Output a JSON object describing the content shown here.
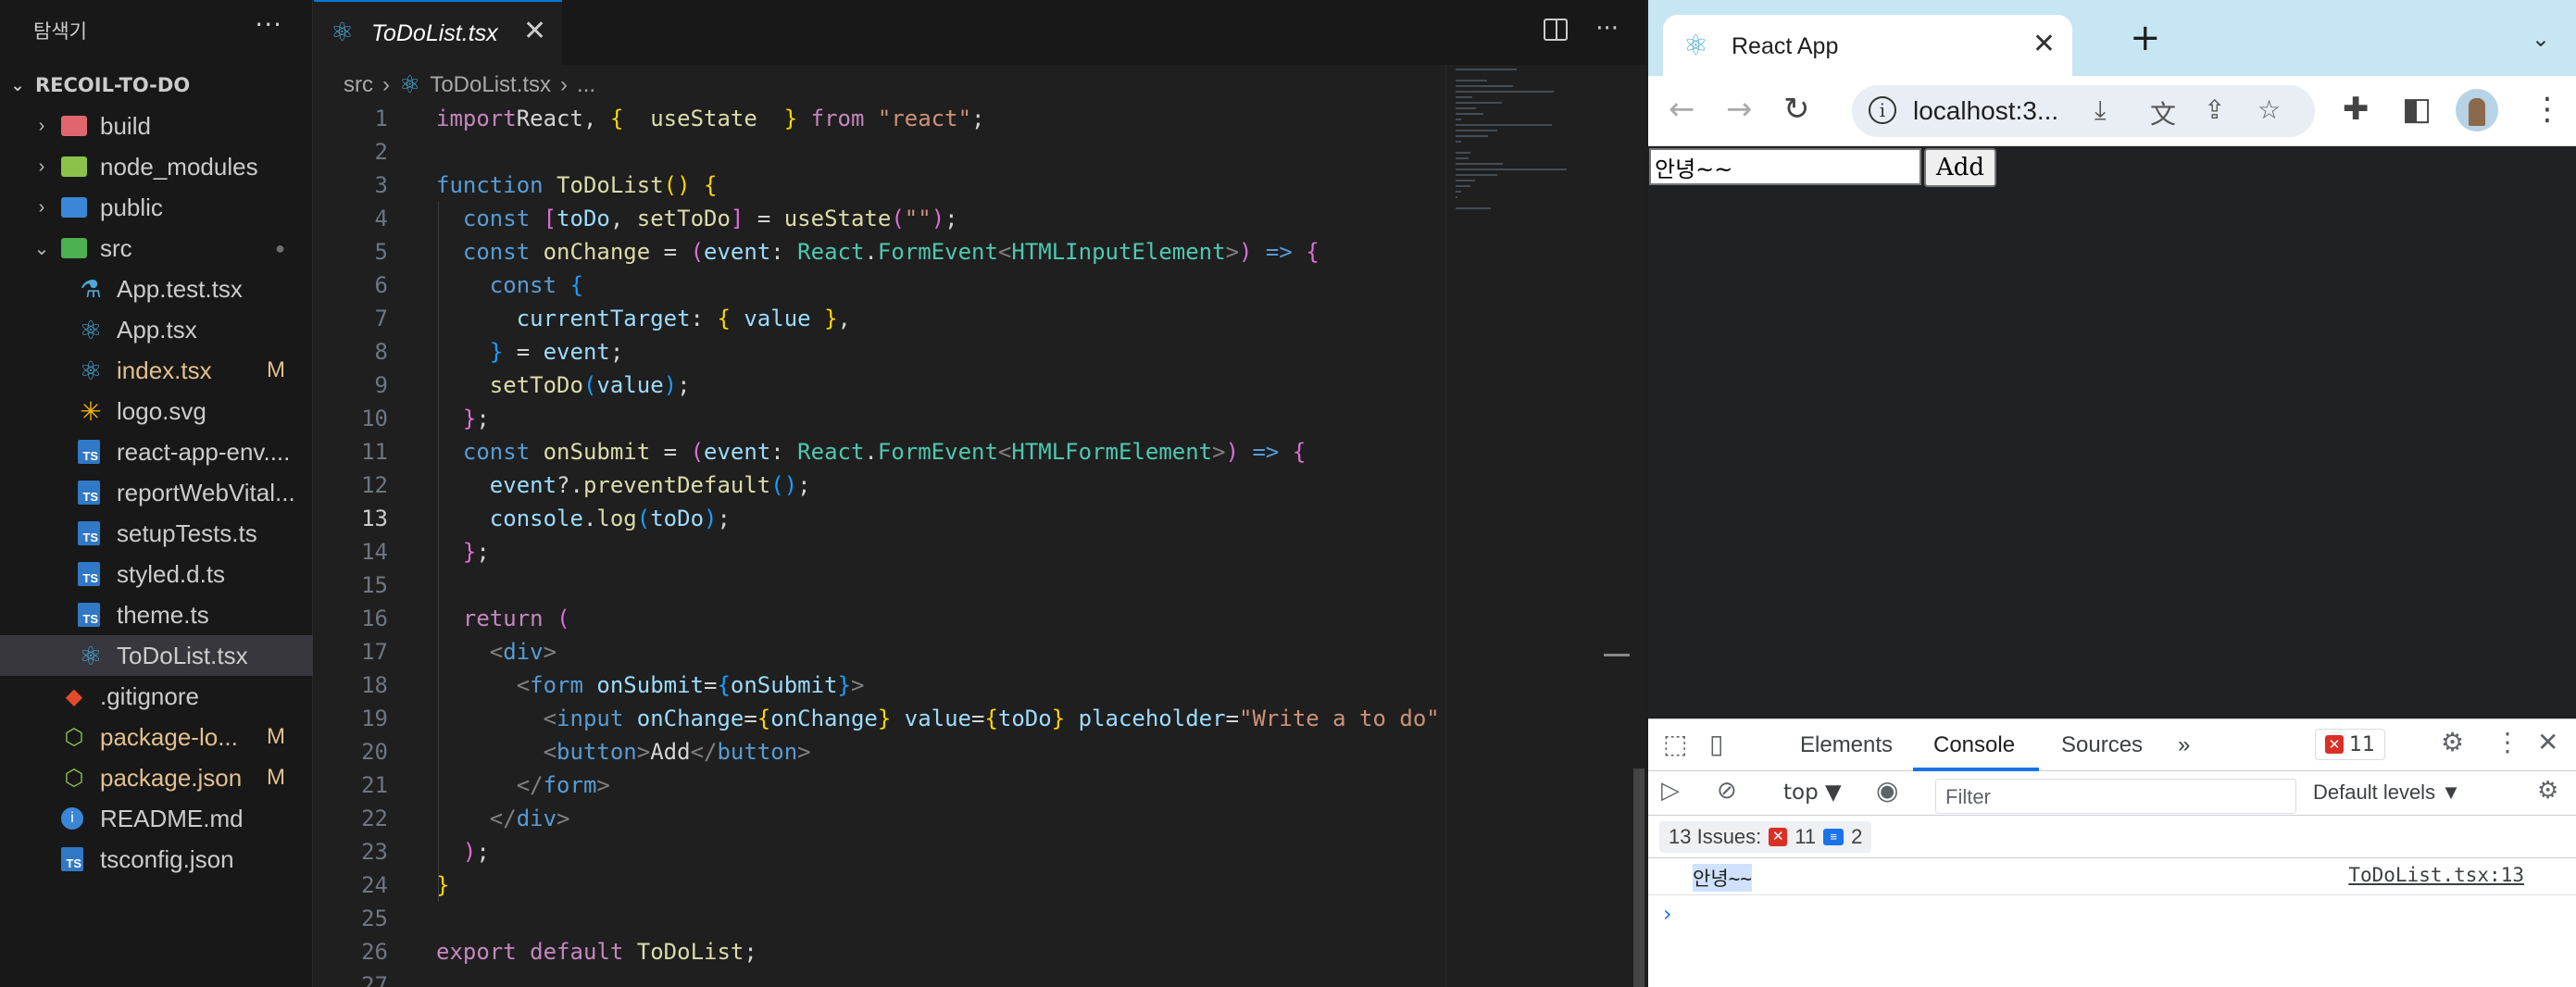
{
  "vscode": {
    "explorer_title": "탐색기",
    "more": "···",
    "root_folder": "RECOIL-TO-DO",
    "tree": [
      {
        "label": "build",
        "kind": "folder",
        "color": "#e0666e",
        "depth": 0,
        "open": false
      },
      {
        "label": "node_modules",
        "kind": "folder",
        "color": "#8bc34a",
        "depth": 0,
        "open": false
      },
      {
        "label": "public",
        "kind": "folder",
        "color": "#3b86d6",
        "depth": 0,
        "open": false
      },
      {
        "label": "src",
        "kind": "folder",
        "color": "#4caf50",
        "depth": 0,
        "open": true,
        "badge": "●"
      },
      {
        "label": "App.test.tsx",
        "kind": "test",
        "depth": 1
      },
      {
        "label": "App.tsx",
        "kind": "react",
        "depth": 1
      },
      {
        "label": "index.tsx",
        "kind": "react",
        "depth": 1,
        "badge": "M",
        "modified": true
      },
      {
        "label": "logo.svg",
        "kind": "svg",
        "depth": 1
      },
      {
        "label": "react-app-env....",
        "kind": "ts",
        "depth": 1
      },
      {
        "label": "reportWebVital...",
        "kind": "ts",
        "depth": 1
      },
      {
        "label": "setupTests.ts",
        "kind": "ts",
        "depth": 1
      },
      {
        "label": "styled.d.ts",
        "kind": "ts",
        "depth": 1
      },
      {
        "label": "theme.ts",
        "kind": "ts",
        "depth": 1
      },
      {
        "label": "ToDoList.tsx",
        "kind": "react",
        "depth": 1,
        "selected": true
      },
      {
        "label": ".gitignore",
        "kind": "git",
        "depth": 0
      },
      {
        "label": "package-lo...",
        "kind": "json",
        "depth": 0,
        "badge": "M",
        "modified": true
      },
      {
        "label": "package.json",
        "kind": "json",
        "depth": 0,
        "badge": "M",
        "modified": true
      },
      {
        "label": "README.md",
        "kind": "info",
        "depth": 0
      },
      {
        "label": "tsconfig.json",
        "kind": "tsjson",
        "depth": 0
      }
    ],
    "tab": {
      "label": "ToDoList.tsx",
      "close": "✕"
    },
    "breadcrumb": [
      "src",
      "ToDoList.tsx",
      "..."
    ],
    "line_numbers": [
      "1",
      "2",
      "3",
      "4",
      "5",
      "6",
      "7",
      "8",
      "9",
      "10",
      "11",
      "12",
      "13",
      "14",
      "15",
      "16",
      "17",
      "18",
      "19",
      "20",
      "21",
      "22",
      "23",
      "24",
      "25",
      "26",
      "27"
    ],
    "active_line": 13
  },
  "code_lines": [
    [
      [
        "kw",
        "import"
      ],
      [
        "",
        "React, "
      ],
      [
        "br1",
        "{"
      ],
      [
        "",
        "  "
      ],
      [
        "fn",
        "useState"
      ],
      [
        "",
        "  "
      ],
      [
        "br1",
        "}"
      ],
      [
        "",
        " "
      ],
      [
        "kw",
        "from"
      ],
      [
        "",
        " "
      ],
      [
        "st",
        "\"react\""
      ],
      [
        "",
        ";"
      ]
    ],
    [],
    [
      [
        "kw2",
        "function"
      ],
      [
        "",
        " "
      ],
      [
        "fn",
        "ToDoList"
      ],
      [
        "br1",
        "()"
      ],
      [
        "",
        " "
      ],
      [
        "br1",
        "{"
      ]
    ],
    [
      [
        "",
        "  "
      ],
      [
        "kw2",
        "const"
      ],
      [
        "",
        " "
      ],
      [
        "br2",
        "["
      ],
      [
        "va",
        "toDo"
      ],
      [
        "",
        ", "
      ],
      [
        "fn",
        "setToDo"
      ],
      [
        "br2",
        "]"
      ],
      [
        "",
        " = "
      ],
      [
        "fn",
        "useState"
      ],
      [
        "br2",
        "("
      ],
      [
        "st",
        "\"\""
      ],
      [
        "br2",
        ")"
      ],
      [
        "",
        ";"
      ]
    ],
    [
      [
        "",
        "  "
      ],
      [
        "kw2",
        "const"
      ],
      [
        "",
        " "
      ],
      [
        "fn",
        "onChange"
      ],
      [
        "",
        " = "
      ],
      [
        "br2",
        "("
      ],
      [
        "va",
        "event"
      ],
      [
        "",
        ": "
      ],
      [
        "ty",
        "React"
      ],
      [
        "",
        "."
      ],
      [
        "ty",
        "FormEvent"
      ],
      [
        "pu",
        "<"
      ],
      [
        "ty",
        "HTMLInputElement"
      ],
      [
        "pu",
        ">"
      ],
      [
        "br2",
        ")"
      ],
      [
        "",
        " "
      ],
      [
        "kw2",
        "=>"
      ],
      [
        "",
        " "
      ],
      [
        "br2",
        "{"
      ]
    ],
    [
      [
        "",
        "    "
      ],
      [
        "kw2",
        "const"
      ],
      [
        "",
        " "
      ],
      [
        "br3",
        "{"
      ]
    ],
    [
      [
        "",
        "      "
      ],
      [
        "va",
        "currentTarget"
      ],
      [
        "",
        ": "
      ],
      [
        "br1",
        "{"
      ],
      [
        "",
        " "
      ],
      [
        "va",
        "value"
      ],
      [
        "",
        " "
      ],
      [
        "br1",
        "}"
      ],
      [
        "",
        ","
      ]
    ],
    [
      [
        "",
        "    "
      ],
      [
        "br3",
        "}"
      ],
      [
        "",
        " = "
      ],
      [
        "va",
        "event"
      ],
      [
        "",
        ";"
      ]
    ],
    [
      [
        "",
        "    "
      ],
      [
        "fn",
        "setToDo"
      ],
      [
        "br3",
        "("
      ],
      [
        "va",
        "value"
      ],
      [
        "br3",
        ")"
      ],
      [
        "",
        ";"
      ]
    ],
    [
      [
        "",
        "  "
      ],
      [
        "br2",
        "}"
      ],
      [
        "",
        ";"
      ]
    ],
    [
      [
        "",
        "  "
      ],
      [
        "kw2",
        "const"
      ],
      [
        "",
        " "
      ],
      [
        "fn",
        "onSubmit"
      ],
      [
        "",
        " = "
      ],
      [
        "br2",
        "("
      ],
      [
        "va",
        "event"
      ],
      [
        "",
        ": "
      ],
      [
        "ty",
        "React"
      ],
      [
        "",
        "."
      ],
      [
        "ty",
        "FormEvent"
      ],
      [
        "pu",
        "<"
      ],
      [
        "ty",
        "HTMLFormElement"
      ],
      [
        "pu",
        ">"
      ],
      [
        "br2",
        ")"
      ],
      [
        "",
        " "
      ],
      [
        "kw2",
        "=>"
      ],
      [
        "",
        " "
      ],
      [
        "br2",
        "{"
      ]
    ],
    [
      [
        "",
        "    "
      ],
      [
        "va",
        "event"
      ],
      [
        "",
        "?."
      ],
      [
        "fn",
        "preventDefault"
      ],
      [
        "br3",
        "()"
      ],
      [
        "",
        ";"
      ]
    ],
    [
      [
        "",
        "    "
      ],
      [
        "va",
        "console"
      ],
      [
        "",
        "."
      ],
      [
        "fn",
        "log"
      ],
      [
        "br3",
        "("
      ],
      [
        "va",
        "toDo"
      ],
      [
        "br3",
        ")"
      ],
      [
        "",
        ";"
      ]
    ],
    [
      [
        "",
        "  "
      ],
      [
        "br2",
        "}"
      ],
      [
        "",
        ";"
      ]
    ],
    [],
    [
      [
        "",
        "  "
      ],
      [
        "kw",
        "return"
      ],
      [
        "",
        " "
      ],
      [
        "br2",
        "("
      ]
    ],
    [
      [
        "",
        "    "
      ],
      [
        "pu",
        "<"
      ],
      [
        "tg",
        "div"
      ],
      [
        "pu",
        ">"
      ]
    ],
    [
      [
        "",
        "      "
      ],
      [
        "pu",
        "<"
      ],
      [
        "tg",
        "form"
      ],
      [
        "",
        " "
      ],
      [
        "at",
        "onSubmit"
      ],
      [
        "",
        "="
      ],
      [
        "br3",
        "{"
      ],
      [
        "va",
        "onSubmit"
      ],
      [
        "br3",
        "}"
      ],
      [
        "pu",
        ">"
      ]
    ],
    [
      [
        "",
        "        "
      ],
      [
        "pu",
        "<"
      ],
      [
        "tg",
        "input"
      ],
      [
        "",
        " "
      ],
      [
        "at",
        "onChange"
      ],
      [
        "",
        "="
      ],
      [
        "br1",
        "{"
      ],
      [
        "va",
        "onChange"
      ],
      [
        "br1",
        "}"
      ],
      [
        "",
        " "
      ],
      [
        "at",
        "value"
      ],
      [
        "",
        "="
      ],
      [
        "br1",
        "{"
      ],
      [
        "va",
        "toDo"
      ],
      [
        "br1",
        "}"
      ],
      [
        "",
        " "
      ],
      [
        "at",
        "placeholder"
      ],
      [
        "",
        "="
      ],
      [
        "st",
        "\"Write a to do\""
      ]
    ],
    [
      [
        "",
        "        "
      ],
      [
        "pu",
        "<"
      ],
      [
        "tg",
        "button"
      ],
      [
        "pu",
        ">"
      ],
      [
        "",
        "Add"
      ],
      [
        "pu",
        "</"
      ],
      [
        "tg",
        "button"
      ],
      [
        "pu",
        ">"
      ]
    ],
    [
      [
        "",
        "      "
      ],
      [
        "pu",
        "</"
      ],
      [
        "tg",
        "form"
      ],
      [
        "pu",
        ">"
      ]
    ],
    [
      [
        "",
        "    "
      ],
      [
        "pu",
        "</"
      ],
      [
        "tg",
        "div"
      ],
      [
        "pu",
        ">"
      ]
    ],
    [
      [
        "",
        "  "
      ],
      [
        "br2",
        ")"
      ],
      [
        "",
        ";"
      ]
    ],
    [
      [
        "br1",
        "}"
      ]
    ],
    [],
    [
      [
        "kw",
        "export"
      ],
      [
        "",
        " "
      ],
      [
        "kw",
        "default"
      ],
      [
        "",
        " "
      ],
      [
        "fn",
        "ToDoList"
      ],
      [
        "",
        ";"
      ]
    ],
    []
  ],
  "chrome": {
    "tab_title": "React App",
    "tab_close": "✕",
    "new_tab": "+",
    "url": "localhost:3...",
    "page": {
      "input_value": "안녕~~",
      "button_label": "Add"
    },
    "devtools": {
      "tabs": [
        "Elements",
        "Console",
        "Sources"
      ],
      "more_tabs": "»",
      "error_count": "11",
      "context": "top ▼",
      "filter_placeholder": "Filter",
      "levels": "Default levels ▼",
      "issues_label": "13 Issues:",
      "issues_errors": "11",
      "issues_info": "2",
      "log_message": "안녕~~",
      "log_source": "ToDoList.tsx:13",
      "prompt": "›"
    }
  }
}
